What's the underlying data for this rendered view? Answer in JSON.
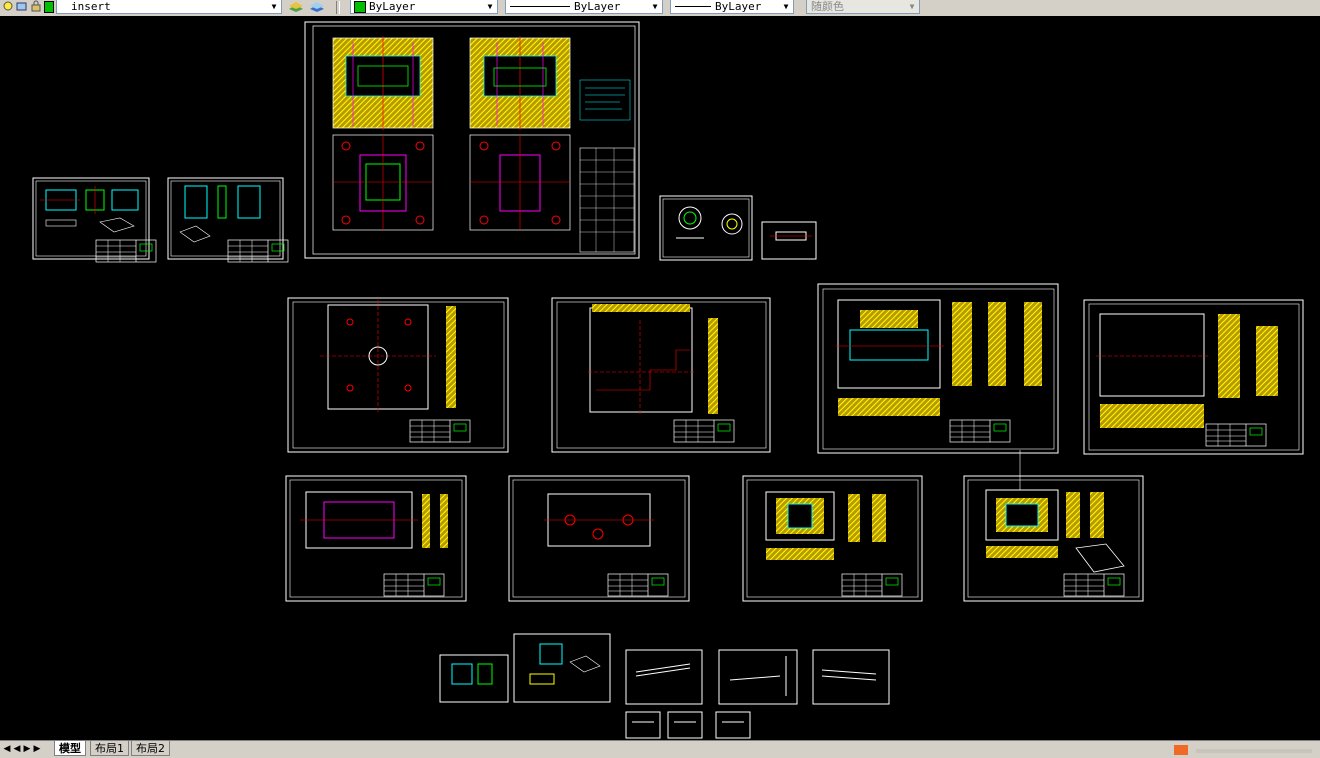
{
  "toolbar": {
    "layer_value": "insert",
    "color_value": "ByLayer",
    "linetype_value": "ByLayer",
    "lineweight_value": "ByLayer",
    "plotstyle_value": "随颜色",
    "icons": [
      "layer-state-icon",
      "layer-properties-icon",
      "layer-lock-icon",
      "layer-color-icon",
      "make-current-icon",
      "layer-previous-icon"
    ]
  },
  "tabs": {
    "model": "模型",
    "layout1": "布局1",
    "layout2": "布局2"
  },
  "colors": {
    "background": "#000000",
    "frame": "#ffffff",
    "green": "#00ff00",
    "yellow": "#ffff00",
    "cyan": "#00ffff",
    "red": "#ff0000",
    "magenta": "#ff00ff"
  }
}
